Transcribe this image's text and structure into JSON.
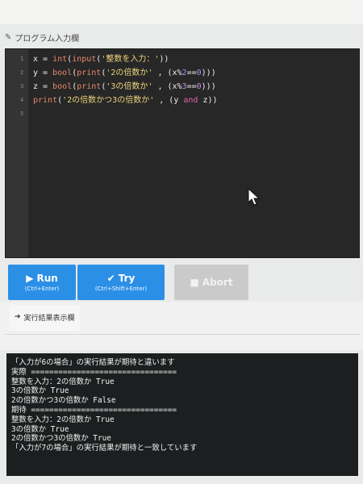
{
  "panel": {
    "title": "プログラム入力欄"
  },
  "editor": {
    "lines": [
      {
        "num": "1",
        "tokens": [
          {
            "t": "x = ",
            "c": ""
          },
          {
            "t": "int",
            "c": "kw"
          },
          {
            "t": "(",
            "c": ""
          },
          {
            "t": "input",
            "c": "kw"
          },
          {
            "t": "(",
            "c": ""
          },
          {
            "t": "'整数を入力：'",
            "c": "str"
          },
          {
            "t": "))",
            "c": ""
          }
        ]
      },
      {
        "num": "2",
        "tokens": [
          {
            "t": "y = ",
            "c": ""
          },
          {
            "t": "bool",
            "c": "kw"
          },
          {
            "t": "(",
            "c": ""
          },
          {
            "t": "print",
            "c": "kw"
          },
          {
            "t": "(",
            "c": ""
          },
          {
            "t": "'2の倍数か'",
            "c": "str"
          },
          {
            "t": " , (x%",
            "c": ""
          },
          {
            "t": "2",
            "c": "num"
          },
          {
            "t": "==",
            "c": ""
          },
          {
            "t": "0",
            "c": "num"
          },
          {
            "t": ")))",
            "c": ""
          }
        ]
      },
      {
        "num": "3",
        "tokens": [
          {
            "t": "z = ",
            "c": ""
          },
          {
            "t": "bool",
            "c": "kw"
          },
          {
            "t": "(",
            "c": ""
          },
          {
            "t": "print",
            "c": "kw"
          },
          {
            "t": "(",
            "c": ""
          },
          {
            "t": "'3の倍数か'",
            "c": "str"
          },
          {
            "t": " , (x%",
            "c": ""
          },
          {
            "t": "3",
            "c": "num"
          },
          {
            "t": "==",
            "c": ""
          },
          {
            "t": "0",
            "c": "num"
          },
          {
            "t": ")))",
            "c": ""
          }
        ]
      },
      {
        "num": "4",
        "tokens": [
          {
            "t": "print",
            "c": "kw"
          },
          {
            "t": "(",
            "c": ""
          },
          {
            "t": "'2の倍数かつ3の倍数か'",
            "c": "str"
          },
          {
            "t": " , (y ",
            "c": ""
          },
          {
            "t": "and",
            "c": "and"
          },
          {
            "t": " z))",
            "c": ""
          }
        ]
      },
      {
        "num": "5",
        "tokens": []
      }
    ]
  },
  "toolbar": {
    "run": {
      "label": "Run",
      "shortcut": "(Ctrl+Enter)"
    },
    "try": {
      "label": "Try",
      "shortcut": "(Ctrl+Shift+Enter)"
    },
    "abort": {
      "label": "Abort"
    }
  },
  "tabs": {
    "results": "実行結果表示欄"
  },
  "output": {
    "lines": [
      "「入力が6の場合」の実行結果が期待と違います",
      "実際 ================================",
      "整数を入力：2の倍数か True",
      "3の倍数か True",
      "2の倍数かつ3の倍数か False",
      "期待 ================================",
      "整数を入力：2の倍数か True",
      "3の倍数か True",
      "2の倍数かつ3の倍数か True",
      "「入力が7の場合」の実行結果が期待と一致しています"
    ]
  },
  "colors": {
    "accent": "#2b8fe6",
    "editor_bg": "#262726",
    "output_bg": "#1c1e1f",
    "keyword": "#e9866b",
    "string": "#f0d57f",
    "number": "#c08cf0",
    "and": "#ea5fa6"
  }
}
